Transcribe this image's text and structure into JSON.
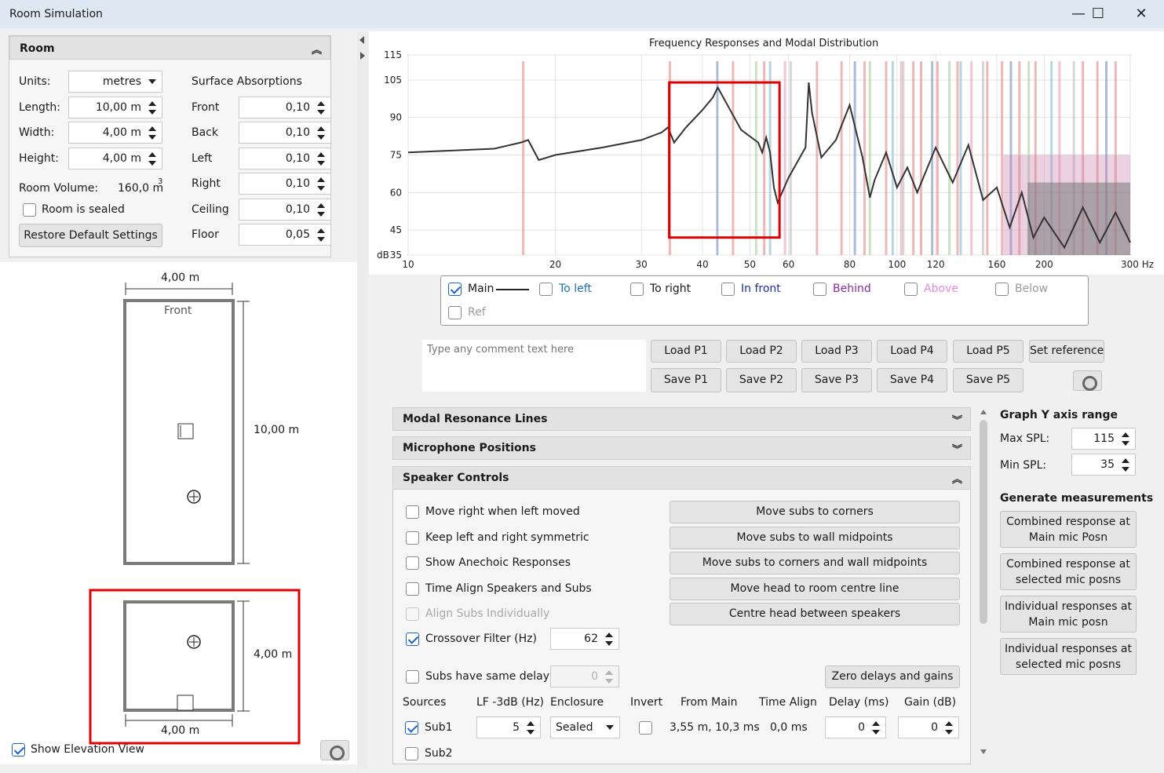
{
  "window": {
    "title": "Room Simulation",
    "minimize": "—",
    "maximize": "☐",
    "close": "✕"
  },
  "room": {
    "header": "Room",
    "units_label": "Units:",
    "units_value": "metres",
    "length_label": "Length:",
    "length_value": "10,00 m",
    "width_label": "Width:",
    "width_value": "4,00 m",
    "height_label": "Height:",
    "height_value": "4,00 m",
    "volume_label": "Room Volume:",
    "volume_value": "160,0 m",
    "volume_sup": "3",
    "sealed_label": "Room is sealed",
    "restore_label": "Restore Default Settings",
    "absorptions_title": "Surface Absorptions",
    "surfaces": [
      {
        "label": "Front",
        "value": "0,10"
      },
      {
        "label": "Back",
        "value": "0,10"
      },
      {
        "label": "Left",
        "value": "0,10"
      },
      {
        "label": "Right",
        "value": "0,10"
      },
      {
        "label": "Ceiling",
        "value": "0,10"
      },
      {
        "label": "Floor",
        "value": "0,05"
      }
    ]
  },
  "plan": {
    "width_dim": "4,00 m",
    "length_dim": "10,00 m",
    "front_label": "Front",
    "elev_height_dim": "4,00 m",
    "elev_width_dim": "4,00 m",
    "show_elevation_label": "Show Elevation View"
  },
  "chart": {
    "title": "Frequency Responses and Modal Distribution",
    "y_unit": "dB",
    "y_ticks": [
      "115",
      "105",
      "90",
      "75",
      "60",
      "45",
      "35"
    ],
    "x_ticks": [
      "10",
      "20",
      "30",
      "40",
      "50",
      "60",
      "80",
      "100",
      "120",
      "160",
      "200",
      "300 Hz"
    ]
  },
  "chart_data": {
    "type": "line",
    "title": "Frequency Responses and Modal Distribution",
    "xlabel": "Hz",
    "ylabel": "dB",
    "ylim": [
      35,
      115
    ],
    "xlim": [
      10,
      300
    ],
    "x_scale": "log",
    "series": [
      {
        "name": "Main",
        "x": [
          10,
          15,
          17,
          17.6,
          18.5,
          20,
          25,
          30,
          33,
          34,
          35,
          37,
          40,
          42,
          43,
          45,
          48,
          52,
          53,
          54,
          55,
          56,
          57,
          60,
          65,
          66,
          67,
          70,
          75,
          80,
          85,
          88,
          90,
          95,
          100,
          105,
          110,
          120,
          130,
          140,
          150,
          160,
          170,
          180,
          190,
          200,
          220,
          240,
          260,
          280,
          300
        ],
        "values": [
          76,
          77.5,
          80,
          81,
          73,
          75,
          78,
          81,
          84,
          86,
          80,
          86,
          93,
          98,
          102,
          95,
          85,
          80,
          76,
          82,
          76,
          62,
          56,
          66,
          78,
          104,
          92,
          74,
          81,
          95,
          74,
          58,
          65,
          76,
          62,
          70,
          60,
          78,
          64,
          79,
          57,
          62,
          46,
          60,
          42,
          50,
          38,
          54,
          40,
          52,
          40
        ]
      }
    ],
    "modal_lines_hz": [
      17.2,
      34.3,
      42.9,
      46.2,
      51.5,
      53.5,
      55,
      59,
      60.6,
      68.6,
      77,
      82,
      85.8,
      88,
      95,
      98,
      102,
      103,
      108,
      112,
      118,
      121,
      128,
      133,
      135,
      142,
      150,
      153,
      164,
      171,
      178,
      186,
      192,
      207,
      215,
      230,
      240,
      257,
      268,
      280
    ]
  },
  "legend": [
    {
      "label": "Main",
      "checked": true,
      "color": "#222222"
    },
    {
      "label": "To left",
      "checked": false,
      "color": "#1e6fc7"
    },
    {
      "label": "To right",
      "checked": false,
      "color": "#1a1a1a"
    },
    {
      "label": "In front",
      "checked": false,
      "color": "#1a2fa8"
    },
    {
      "label": "Behind",
      "checked": false,
      "color": "#8a2aa0"
    },
    {
      "label": "Above",
      "checked": false,
      "color": "#e08ae0"
    },
    {
      "label": "Below",
      "checked": false,
      "color": "#9a9a9a"
    },
    {
      "label": "Ref",
      "checked": false,
      "color": "#9a9a9a"
    }
  ],
  "comment": {
    "placeholder": "Type any comment text here"
  },
  "presets": {
    "load": [
      "Load P1",
      "Load P2",
      "Load P3",
      "Load P4",
      "Load P5"
    ],
    "save": [
      "Save P1",
      "Save P2",
      "Save P3",
      "Save P4",
      "Save P5"
    ],
    "set_reference": "Set reference"
  },
  "sections": {
    "modal": "Modal Resonance Lines",
    "mic": "Microphone Positions",
    "speaker": "Speaker Controls"
  },
  "speaker": {
    "options": [
      {
        "label": "Move right when left moved",
        "checked": false,
        "disabled": false
      },
      {
        "label": "Keep left and right symmetric",
        "checked": false,
        "disabled": false
      },
      {
        "label": "Show Anechoic Responses",
        "checked": false,
        "disabled": false
      },
      {
        "label": "Time Align Speakers and Subs",
        "checked": false,
        "disabled": false
      },
      {
        "label": "Align Subs Individually",
        "checked": false,
        "disabled": true
      },
      {
        "label": "Crossover Filter (Hz)",
        "checked": true,
        "disabled": false
      }
    ],
    "crossover_value": "62",
    "actions": [
      "Move subs to corners",
      "Move subs to wall midpoints",
      "Move subs to corners and wall midpoints",
      "Move head to room centre line",
      "Centre head between speakers"
    ],
    "same_delay_label": "Subs have same delay",
    "same_delay_value": "0",
    "zero_label": "Zero delays and gains",
    "columns": [
      "Sources",
      "LF -3dB (Hz)",
      "Enclosure",
      "Invert",
      "From Main",
      "Time Align",
      "Delay (ms)",
      "Gain (dB)"
    ],
    "sub1": {
      "name": "Sub1",
      "lf": "5",
      "enclosure": "Sealed",
      "from_main": "3,55 m, 10,3 ms",
      "time_align": "0,0 ms",
      "delay": "0",
      "gain": "0"
    },
    "sub2": {
      "name": "Sub2"
    }
  },
  "graph_range": {
    "title": "Graph Y axis range",
    "max_label": "Max SPL:",
    "max_value": "115",
    "min_label": "Min SPL:",
    "min_value": "35"
  },
  "measure": {
    "title": "Generate measurements",
    "buttons": [
      [
        "Combined response at",
        "Main mic Posn"
      ],
      [
        "Combined response at",
        "selected mic posns"
      ],
      [
        "Individual responses at",
        "Main mic posn"
      ],
      [
        "Individual responses at",
        "selected mic posns"
      ]
    ]
  },
  "colors": {
    "highlight": "#e00000",
    "accent": "#1e63c8"
  }
}
